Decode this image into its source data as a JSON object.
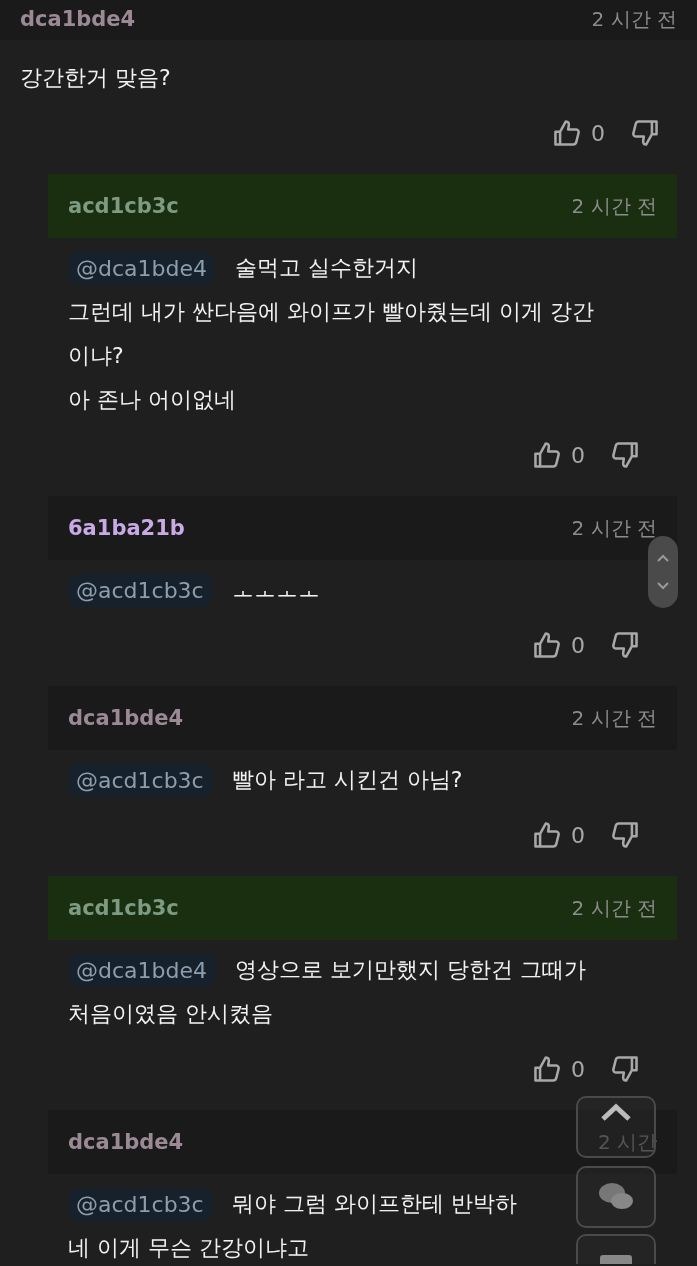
{
  "comments": [
    {
      "author": "dca1bde4",
      "color": "#9b8a95",
      "time": "2 시간 전",
      "highlighted": false,
      "body": [
        "강간한거 맞음?"
      ],
      "likes": "0",
      "children": [
        {
          "author": "acd1cb3c",
          "color": "#7d9a82",
          "time": "2 시간 전",
          "highlighted": true,
          "mention": "@dca1bde4",
          "body": [
            "술먹고 실수한거지",
            "그런데 내가 싼다음에 와이프가 빨아줬는데 이게 강간",
            "이냐?",
            "아 존나 어이없네"
          ],
          "likes": "0"
        },
        {
          "author": "6a1ba21b",
          "color": "#c9aae6",
          "time": "2 시간 전",
          "highlighted": false,
          "mention": "@acd1cb3c",
          "body": [
            "ㅗㅗㅗㅗ"
          ],
          "likes": "0"
        },
        {
          "author": "dca1bde4",
          "color": "#9b8a95",
          "time": "2 시간 전",
          "highlighted": false,
          "mention": "@acd1cb3c",
          "body": [
            "빨아 라고 시킨건 아님?"
          ],
          "likes": "0"
        },
        {
          "author": "acd1cb3c",
          "color": "#7d9a82",
          "time": "2 시간 전",
          "highlighted": true,
          "mention": "@dca1bde4",
          "body": [
            "영상으로 보기만했지 당한건 그때가",
            "처음이였음 안시켰음"
          ],
          "likes": "0"
        },
        {
          "author": "dca1bde4",
          "color": "#9b8a95",
          "time": "2 시간",
          "highlighted": false,
          "mention": "@acd1cb3c",
          "body": [
            "뭐야 그럼 와이프한테 반박하",
            "네 이게 무슨 간강이냐고"
          ]
        }
      ]
    }
  ]
}
